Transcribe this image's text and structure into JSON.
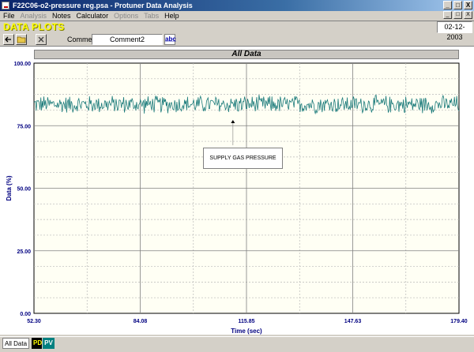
{
  "window": {
    "title": "F22C06-o2-pressure reg.psa - Protuner Data  Analysis",
    "buttons": [
      "_",
      "□",
      "X"
    ]
  },
  "menu": [
    {
      "label": "File",
      "enabled": true
    },
    {
      "label": "Analysis",
      "enabled": false
    },
    {
      "label": "Notes",
      "enabled": true
    },
    {
      "label": "Calculator",
      "enabled": true
    },
    {
      "label": "Options",
      "enabled": false
    },
    {
      "label": "Tabs",
      "enabled": false
    },
    {
      "label": "Help",
      "enabled": true
    }
  ],
  "header": {
    "title": "DATA PLOTS",
    "date": "02-12-2003"
  },
  "toolbar": {
    "comment_label": "Comment",
    "comment_value": "Comment2",
    "abc_label": "a̲b̲c̲"
  },
  "plot": {
    "title": "All Data",
    "annotation": "SUPPLY GAS PRESSURE"
  },
  "chart_data": {
    "type": "line",
    "xlabel": "Time (sec)",
    "ylabel": "Data (%)",
    "xlim": [
      52.3,
      179.4
    ],
    "ylim": [
      0,
      100
    ],
    "x_ticks": [
      "52.30",
      "84.08",
      "115.85",
      "147.63",
      "179.40"
    ],
    "y_ticks": [
      "0.00",
      "25.00",
      "50.00",
      "75.00",
      "100.00"
    ],
    "grid": true,
    "series": [
      {
        "color": "#1a7a7a",
        "mean": 83.2,
        "noise_range": [
          79.5,
          87.5
        ],
        "samples": 560
      }
    ],
    "annotation_point": {
      "x": 111.8,
      "y": 77.3
    }
  },
  "colors": {
    "axis_text": "#000080",
    "grid": "#b8b8b8",
    "trace": "#1a7a7a",
    "header_title": "#ffff00"
  },
  "statusbar": {
    "tabs": [
      "All Data",
      "PD",
      "PV"
    ]
  }
}
